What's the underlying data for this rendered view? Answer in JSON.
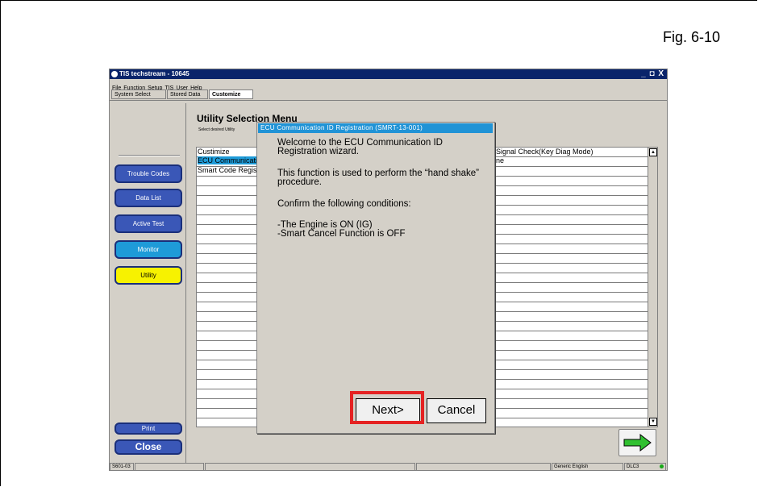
{
  "figure_label": "Fig. 6-10",
  "window": {
    "title": "TIS techstream - 10645",
    "controls": "_ ◘ X"
  },
  "menu": [
    "File",
    "Function",
    "Setup",
    "TIS",
    "User",
    "Help"
  ],
  "tabs": [
    {
      "label": "System Select",
      "active": false
    },
    {
      "label": "Stored Data",
      "active": false
    },
    {
      "label": "Customize",
      "active": true
    }
  ],
  "sidebar": {
    "buttons": [
      {
        "label": "Trouble Codes"
      },
      {
        "label": "Data List"
      },
      {
        "label": "Active Test"
      },
      {
        "label": "Monitor"
      },
      {
        "label": "Utility"
      }
    ],
    "print_label": "Print",
    "close_label": "Close"
  },
  "utility": {
    "title": "Utility Selection Menu",
    "subtitle": "Select desired Utility",
    "rows_left": [
      "Custimize",
      "ECU Communication ID Registration",
      "Smart Code Registration"
    ],
    "rows_right": [
      "Signal Check(Key Diag Mode)",
      "ne"
    ]
  },
  "dialog": {
    "title": "ECU Communication ID Registration (SMRT-13-001)",
    "para1": "Welcome to the ECU Communication ID Registration wizard.",
    "para2": "This function is used to perform the “hand shake” procedure.",
    "para3": "Confirm the following conditions:",
    "cond1": "-The Engine is ON (IG)",
    "cond2": "-Smart Cancel Function is OFF",
    "next_label": "Next>",
    "cancel_label": "Cancel"
  },
  "status": {
    "code": "S601-03",
    "language": "Generic English",
    "connector": "DLC3"
  },
  "colors": {
    "highlight": "#e52222",
    "dialog_title": "#2093d6",
    "utility_button": "#f7f200"
  }
}
